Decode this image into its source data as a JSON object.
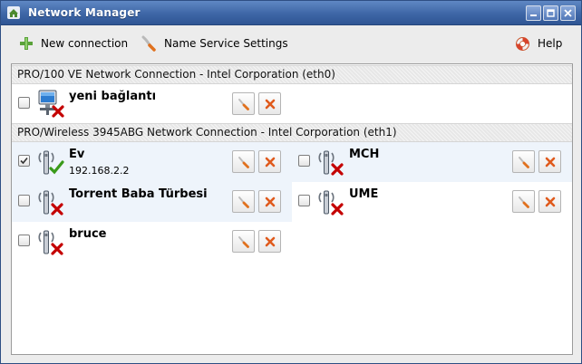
{
  "window": {
    "title": "Network Manager"
  },
  "toolbar": {
    "new_connection": "New connection",
    "name_service": "Name Service Settings",
    "help": "Help"
  },
  "groups": [
    {
      "header": "PRO/100 VE Network Connection - Intel Corporation (eth0)",
      "connections": [
        {
          "name": "yeni bağlantı",
          "ip": "",
          "checked": false,
          "connected": false,
          "type": "wired",
          "icon": "wired-network-icon"
        }
      ]
    },
    {
      "header": "PRO/Wireless 3945ABG Network Connection - Intel Corporation (eth1)",
      "connections": [
        {
          "name": "Ev",
          "ip": "192.168.2.2",
          "checked": true,
          "connected": true,
          "type": "wireless",
          "icon": "wireless-network-icon"
        },
        {
          "name": "MCH",
          "ip": "",
          "checked": false,
          "connected": false,
          "type": "wireless",
          "icon": "wireless-network-icon"
        },
        {
          "name": "Torrent Baba Türbesi",
          "ip": "",
          "checked": false,
          "connected": false,
          "type": "wireless",
          "icon": "wireless-network-icon"
        },
        {
          "name": "UME",
          "ip": "",
          "checked": false,
          "connected": false,
          "type": "wireless",
          "icon": "wireless-network-icon"
        },
        {
          "name": "bruce",
          "ip": "",
          "checked": false,
          "connected": false,
          "type": "wireless",
          "icon": "wireless-network-icon"
        }
      ]
    }
  ],
  "colors": {
    "titlebar": "#3e66a6",
    "highlight_row": "#eef4fb",
    "delete_x": "#e05a1c",
    "status_ok": "#3a9a1a",
    "status_error": "#c40000"
  }
}
